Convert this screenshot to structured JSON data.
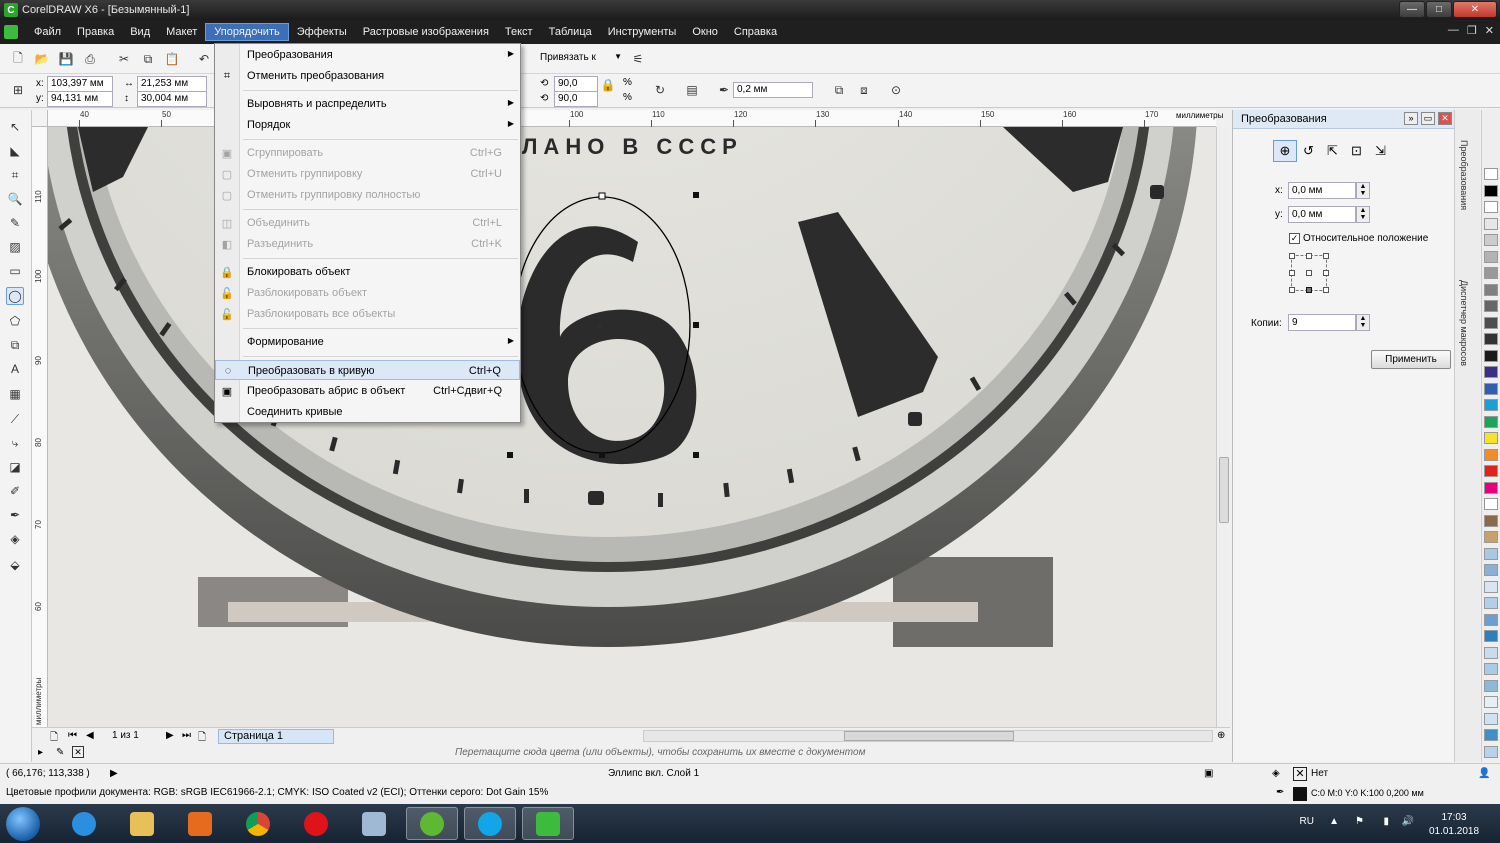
{
  "window": {
    "title": "CorelDRAW X6 - [Безымянный-1]"
  },
  "menubar": {
    "items": [
      "Файл",
      "Правка",
      "Вид",
      "Макет",
      "Упорядочить",
      "Эффекты",
      "Растровые изображения",
      "Текст",
      "Таблица",
      "Инструменты",
      "Окно",
      "Справка"
    ],
    "active_index": 4
  },
  "toolbar": {
    "snap_label": "Привязать к"
  },
  "propbar": {
    "x": "103,397 мм",
    "y": "94,131 мм",
    "width": "21,253 мм",
    "height": "30,004 мм",
    "scale_w": "90,0",
    "scale_h": "90,0",
    "scale_unit": "%",
    "outline": "0,2 мм"
  },
  "ruler": {
    "units": "миллиметры",
    "h_ticks": [
      "40",
      "50",
      "100",
      "110",
      "120",
      "130",
      "140",
      "150",
      "160",
      "170"
    ],
    "v_ticks": [
      "110",
      "100",
      "90",
      "80",
      "70",
      "60"
    ]
  },
  "dropdown": {
    "items": [
      {
        "label": "Преобразования",
        "shortcut": "",
        "submenu": true,
        "disabled": false,
        "icon": ""
      },
      {
        "label": "Отменить преобразования",
        "shortcut": "",
        "submenu": false,
        "disabled": false,
        "icon": "clear-transform-icon"
      },
      {
        "sep": true
      },
      {
        "label": "Выровнять и распределить",
        "shortcut": "",
        "submenu": true,
        "disabled": false,
        "icon": ""
      },
      {
        "label": "Порядок",
        "shortcut": "",
        "submenu": true,
        "disabled": false,
        "icon": ""
      },
      {
        "sep": true
      },
      {
        "label": "Сгруппировать",
        "shortcut": "Ctrl+G",
        "submenu": false,
        "disabled": true,
        "icon": "group-icon"
      },
      {
        "label": "Отменить группировку",
        "shortcut": "Ctrl+U",
        "submenu": false,
        "disabled": true,
        "icon": "ungroup-icon"
      },
      {
        "label": "Отменить группировку полностью",
        "shortcut": "",
        "submenu": false,
        "disabled": true,
        "icon": "ungroup-all-icon"
      },
      {
        "sep": true
      },
      {
        "label": "Объединить",
        "shortcut": "Ctrl+L",
        "submenu": false,
        "disabled": true,
        "icon": "combine-icon"
      },
      {
        "label": "Разъединить",
        "shortcut": "Ctrl+K",
        "submenu": false,
        "disabled": true,
        "icon": "break-apart-icon"
      },
      {
        "sep": true
      },
      {
        "label": "Блокировать объект",
        "shortcut": "",
        "submenu": false,
        "disabled": false,
        "icon": "lock-icon"
      },
      {
        "label": "Разблокировать объект",
        "shortcut": "",
        "submenu": false,
        "disabled": true,
        "icon": "unlock-icon"
      },
      {
        "label": "Разблокировать все объекты",
        "shortcut": "",
        "submenu": false,
        "disabled": true,
        "icon": "unlock-all-icon"
      },
      {
        "sep": true
      },
      {
        "label": "Формирование",
        "shortcut": "",
        "submenu": true,
        "disabled": false,
        "icon": ""
      },
      {
        "sep": true
      },
      {
        "label": "Преобразовать в кривую",
        "shortcut": "Ctrl+Q",
        "submenu": false,
        "disabled": false,
        "icon": "convert-curve-icon",
        "highlight": true
      },
      {
        "label": "Преобразовать абрис в объект",
        "shortcut": "Ctrl+Сдвиг+Q",
        "submenu": false,
        "disabled": false,
        "icon": "outline-to-object-icon"
      },
      {
        "label": "Соединить кривые",
        "shortcut": "",
        "submenu": false,
        "disabled": false,
        "icon": ""
      }
    ]
  },
  "canvas": {
    "dial_text": "ЛАНО В СССР",
    "digit": "6"
  },
  "pagenav": {
    "counter": "1 из 1",
    "page_tab": "Страница 1",
    "hint": "Перетащите сюда цвета (или объекты), чтобы сохранить их вместе с документом"
  },
  "status": {
    "coords": "( 66,176; 113,338 )",
    "object_info": "Эллипс вкл. Слой 1",
    "fill_label": "Нет",
    "color_profiles": "Цветовые профили документа: RGB: sRGB IEC61966-2.1; CMYK: ISO Coated v2 (ECI); Оттенки серого: Dot Gain 15%",
    "outline_info": "C:0 M:0 Y:0 K:100  0,200 мм"
  },
  "docker": {
    "title": "Преобразования",
    "x_label": "x:",
    "x_value": "0,0 мм",
    "y_label": "y:",
    "y_value": "0,0 мм",
    "relative_label": "Относительное положение",
    "relative_checked": true,
    "copies_label": "Копии:",
    "copies_value": "9",
    "apply_label": "Применить",
    "tab1": "Преобразования",
    "tab2": "Диспетчер макросов"
  },
  "palette": [
    "#ffffff",
    "#000000",
    "#ffffff",
    "#e6e6e6",
    "#cccccc",
    "#b3b3b3",
    "#999999",
    "#808080",
    "#666666",
    "#4d4d4d",
    "#333333",
    "#1a1a1a",
    "#3a2f86",
    "#2e5fb5",
    "#1a9fd6",
    "#1aa65a",
    "#f5e32a",
    "#f28c28",
    "#e2231a",
    "#e6007e",
    "#ffffff",
    "#8a6a4a",
    "#c8a06a",
    "#a8c8e8",
    "#8ab0d8",
    "#d7e6f2",
    "#b0d0e8",
    "#6a9fcf",
    "#2f7fbf",
    "#c8dcec",
    "#a9cbe4",
    "#8db9d9",
    "#e6eef6",
    "#cfe2f2",
    "#3f8fc9",
    "#b8d2ea"
  ],
  "taskbar": {
    "lang": "RU",
    "time": "17:03",
    "date": "01.01.2018"
  }
}
